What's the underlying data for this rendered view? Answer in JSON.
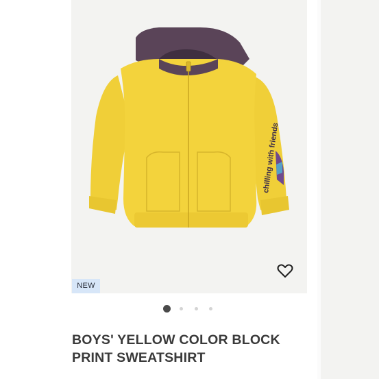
{
  "product": {
    "badge": "NEW",
    "title_line1": "BOYS' YELLOW COLOR BLOCK",
    "title_line2": "PRINT SWEATSHIRT",
    "sleeve_print": "chilling with friends",
    "wishlist_icon": "heart-outline-icon"
  },
  "carousel": {
    "slides": 4,
    "active_index": 0
  },
  "colors": {
    "body": "#f3d33c",
    "hood": "#5a4458",
    "badge_bg": "#d7e6f8"
  }
}
